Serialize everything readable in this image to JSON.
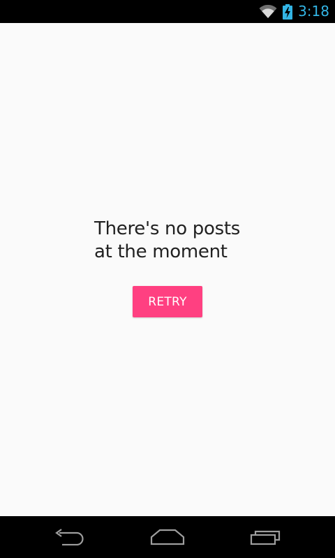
{
  "status_bar": {
    "time": "3:18",
    "icons": [
      "wifi-icon",
      "battery-charging-icon"
    ],
    "time_color": "#33b5e5"
  },
  "main": {
    "message": "There's no posts at the moment",
    "retry_label": "RETRY",
    "accent_color": "#ff4081"
  },
  "nav_bar": {
    "buttons": [
      "back-icon",
      "home-icon",
      "recents-icon"
    ]
  }
}
